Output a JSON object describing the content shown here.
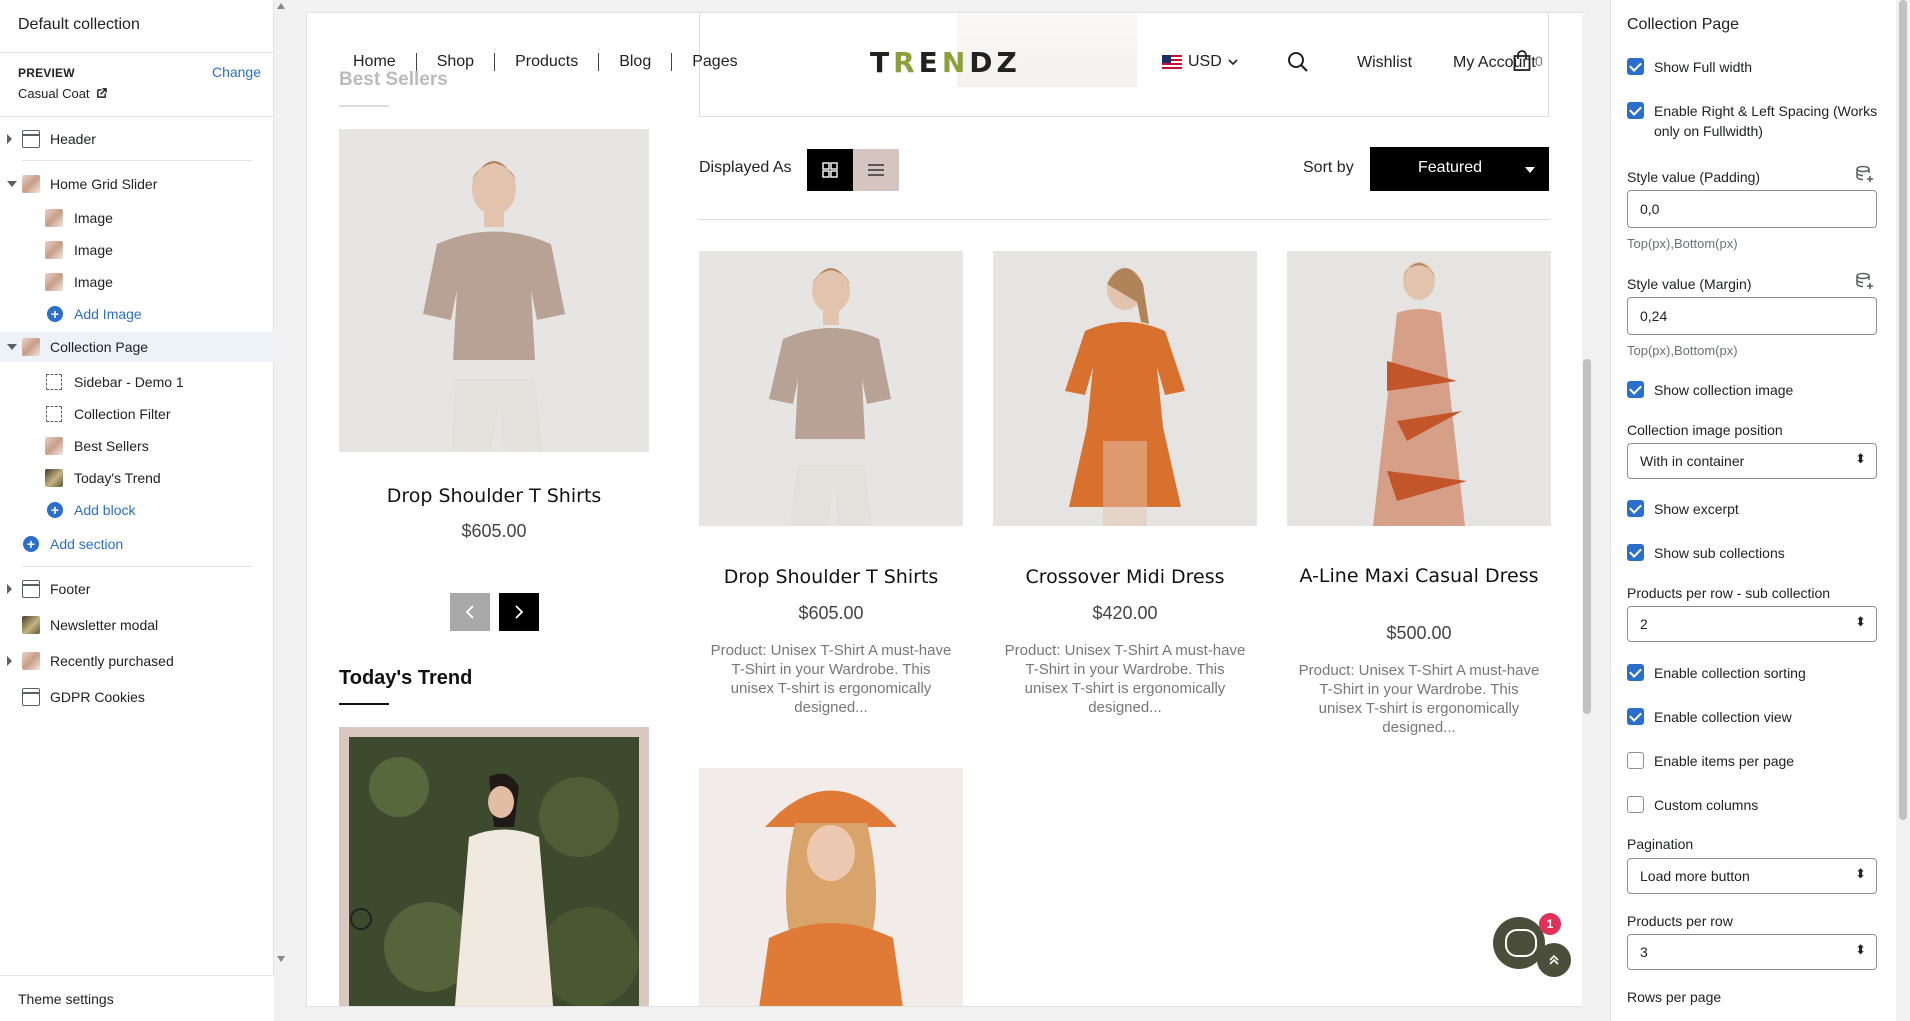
{
  "left": {
    "title": "Default collection",
    "preview_label": "PREVIEW",
    "change_label": "Change",
    "preview_value": "Casual Coat",
    "tree": {
      "header": "Header",
      "home_grid_slider": "Home Grid Slider",
      "image1": "Image",
      "image2": "Image",
      "image3": "Image",
      "add_image": "Add Image",
      "collection_page": "Collection Page",
      "sidebar_demo": "Sidebar - Demo 1",
      "collection_filter": "Collection Filter",
      "best_sellers": "Best Sellers",
      "todays_trend": "Today's Trend",
      "add_block": "Add block",
      "add_section": "Add section",
      "footer": "Footer",
      "newsletter": "Newsletter modal",
      "recently_purchased": "Recently purchased",
      "gdpr": "GDPR Cookies"
    },
    "theme_settings": "Theme settings"
  },
  "store": {
    "nav": [
      "Home",
      "Shop",
      "Products",
      "Blog",
      "Pages"
    ],
    "logo": {
      "pre": "T",
      "g1": "R",
      "mid": "E",
      "g2": "N",
      "post": "DZ"
    },
    "currency": "USD",
    "wishlist": "Wishlist",
    "account": "My Account",
    "cart_count": "0",
    "best_sellers_heading": "Best Sellers",
    "sidebar_product": {
      "name": "Drop Shoulder T Shirts",
      "price": "$605.00"
    },
    "todays_trend_heading": "Today's Trend",
    "displayed_as": "Displayed As",
    "sort_by": "Sort by",
    "sort_value": "Featured",
    "products": [
      {
        "name": "Drop Shoulder T Shirts",
        "price": "$605.00",
        "desc": "Product: Unisex T-Shirt A must-have T-Shirt in your Wardrobe. This unisex T-shirt is ergonomically designed..."
      },
      {
        "name": "Crossover Midi Dress",
        "price": "$420.00",
        "desc": "Product: Unisex T-Shirt A must-have T-Shirt in your Wardrobe. This unisex T-shirt is ergonomically designed..."
      },
      {
        "name": "A-Line Maxi Casual Dress",
        "price": "$500.00",
        "desc": "Product: Unisex T-Shirt A must-have T-Shirt in your Wardrobe. This unisex T-shirt is ergonomically designed..."
      }
    ],
    "chat_badge": "1"
  },
  "right": {
    "title": "Collection Page",
    "show_full_width": {
      "label": "Show Full width",
      "checked": true
    },
    "enable_spacing": {
      "label": "Enable Right & Left Spacing (Works only on Fullwidth)",
      "checked": true
    },
    "padding": {
      "label": "Style value (Padding)",
      "value": "0,0",
      "help": "Top(px),Bottom(px)"
    },
    "margin": {
      "label": "Style value (Margin)",
      "value": "0,24",
      "help": "Top(px),Bottom(px)"
    },
    "show_collection_image": {
      "label": "Show collection image",
      "checked": true
    },
    "image_position": {
      "label": "Collection image position",
      "value": "With in container"
    },
    "show_excerpt": {
      "label": "Show excerpt",
      "checked": true
    },
    "show_sub_collections": {
      "label": "Show sub collections",
      "checked": true
    },
    "products_per_row_sub": {
      "label": "Products per row - sub collection",
      "value": "2"
    },
    "enable_sorting": {
      "label": "Enable collection sorting",
      "checked": true
    },
    "enable_view": {
      "label": "Enable collection view",
      "checked": true
    },
    "enable_items_per_page": {
      "label": "Enable items per page",
      "checked": false
    },
    "custom_columns": {
      "label": "Custom columns",
      "checked": false
    },
    "pagination": {
      "label": "Pagination",
      "value": "Load more button"
    },
    "products_per_row": {
      "label": "Products per row",
      "value": "3"
    },
    "rows_per_page": {
      "label": "Rows per page"
    }
  },
  "colors": {
    "accent": "#2c6ecb",
    "logo_green": "#8aa03a"
  }
}
